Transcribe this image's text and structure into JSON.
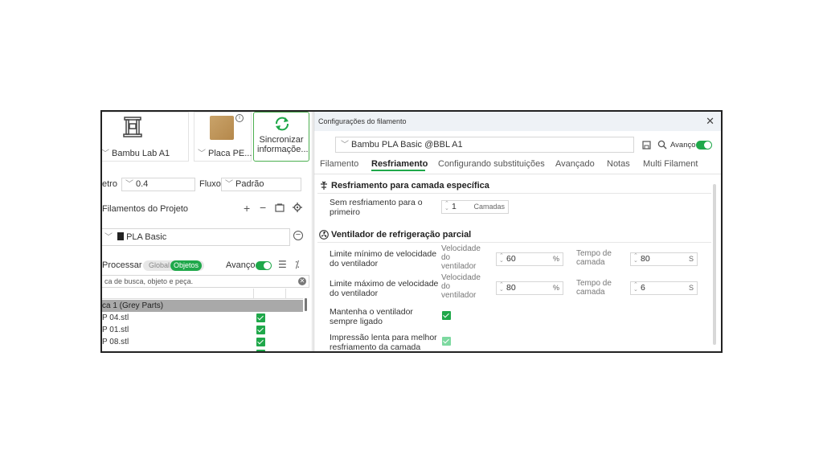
{
  "left": {
    "printer_name": "Bambu Lab A1",
    "plate_name": "Placa PE...",
    "sync_line1": "Sincronizar",
    "sync_line2": "informaçõe...",
    "nozzle_label": "etro",
    "nozzle_value": "0.4",
    "flow_label": "Fluxo",
    "flow_value": "Padrão",
    "filaments_title": "Filamentos do Projeto",
    "filament_name": "PLA Basic",
    "process_label": "Processar",
    "global_pill": "Global",
    "objects_pill": "Objetos",
    "advanced_label": "Avanço",
    "search_placeholder": "ca de busca, objeto e peça.",
    "plate_row": "ca 1 (Grey Parts)",
    "objects": [
      {
        "name": "P 04.stl"
      },
      {
        "name": "P 01.stl"
      },
      {
        "name": "P 08.stl"
      }
    ]
  },
  "dialog": {
    "title": "Configurações do filamento",
    "preset": "Bambu PLA Basic @BBL A1",
    "advanced_label": "Avanço",
    "tabs": [
      "Filamento",
      "Resfriamento",
      "Configurando substituições",
      "Avançado",
      "Notas",
      "Multi Filament"
    ],
    "group1": {
      "title": "Resfriamento para camada específica",
      "no_cooling_label_1": "Sem resfriamento para o",
      "no_cooling_label_2": "primeiro",
      "no_cooling_value": "1",
      "no_cooling_unit": "Camadas"
    },
    "group2": {
      "title": "Ventilador de refrigeração parcial",
      "min_label_1": "Limite mínimo de velocidade",
      "min_label_2": "do ventilador",
      "max_label_1": "Limite máximo de velocidade",
      "max_label_2": "do ventilador",
      "fan_speed_1": "Velocidade",
      "fan_speed_2": "do",
      "fan_speed_3": "ventilador",
      "layer_time_1": "Tempo de",
      "layer_time_2": "camada",
      "min_speed": "60",
      "min_time": "80",
      "max_speed": "80",
      "max_time": "6",
      "pct_unit": "%",
      "s_unit": "S",
      "keep_fan_1": "Mantenha o ventilador",
      "keep_fan_2": "sempre ligado",
      "slow_print_1": "Impressão lenta para melhor",
      "slow_print_2": "resfriamento da camada"
    }
  }
}
